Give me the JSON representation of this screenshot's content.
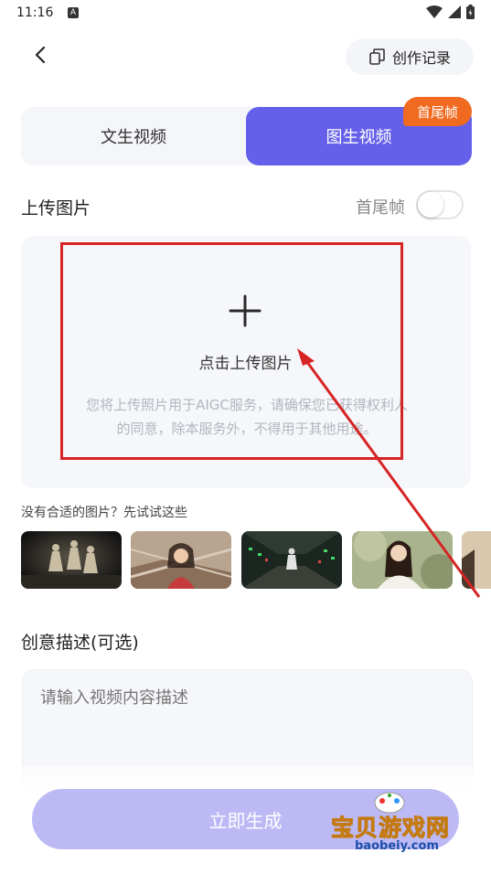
{
  "status": {
    "time": "11:16",
    "notification_badge": "A"
  },
  "header": {
    "back_icon": "chevron-left-icon",
    "records_label": "创作记录",
    "records_icon": "copy-icon"
  },
  "tabs": [
    {
      "label": "文生视频",
      "active": false
    },
    {
      "label": "图生视频",
      "active": true
    }
  ],
  "badge_label": "首尾帧",
  "upload": {
    "section_title": "上传图片",
    "toggle_label": "首尾帧",
    "toggle_on": false,
    "upload_label": "点击上传图片",
    "hint_line1": "您将上传照片用于AIGC服务，请确保您已获得权利人",
    "hint_line2": "的同意，除本服务外，不得用于其他用途。"
  },
  "samples": {
    "title": "没有合适的图片？先试试这些",
    "items": [
      "dancers-thumb",
      "smiling-woman-thumb",
      "corridor-runner-thumb",
      "woman-portrait-thumb",
      "partial-thumb"
    ]
  },
  "description": {
    "title": "创意描述(可选)",
    "placeholder": "请输入视频内容描述"
  },
  "generate_label": "立即生成",
  "watermark": {
    "text": "宝贝游戏网",
    "url": "baobeiy.com"
  },
  "colors": {
    "accent": "#6460ea",
    "badge": "#f06a1f",
    "button_disabled": "#bcb9f5",
    "annotation": "#d62424"
  }
}
